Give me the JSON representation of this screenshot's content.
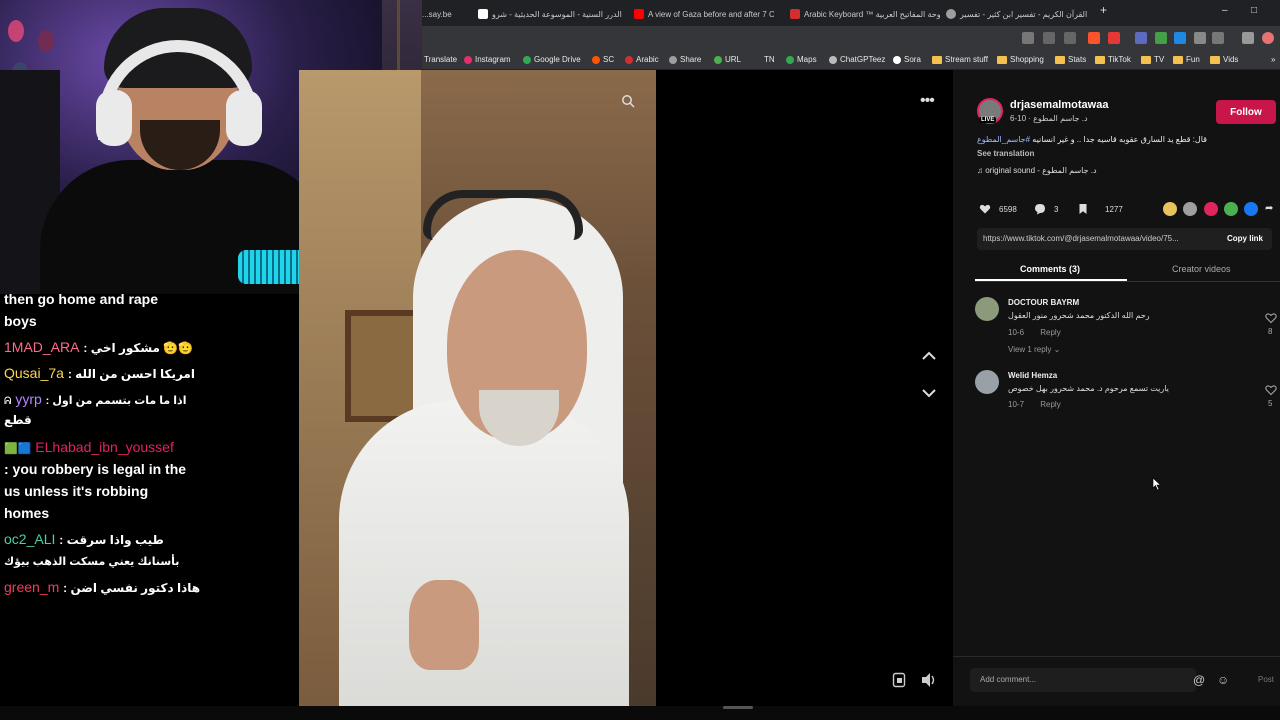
{
  "browser": {
    "tabs": [
      {
        "title": "...say.be",
        "fav_color": "#4a4a4a"
      },
      {
        "title": "الدرر السنية - الموسوعة الحديثية - شرو",
        "fav_color": "#ffffff"
      },
      {
        "title": "A view of Gaza before and after 7 Oc",
        "fav_color": "#ff0000"
      },
      {
        "title": "Arabic Keyboard ™ لوحة المفاتيح العربية",
        "fav_color": "#d32f2f"
      },
      {
        "title": "القرآن الكريم - تفسير ابن كثير - تفسير",
        "fav_color": "#9e9e9e"
      }
    ],
    "new_tab": "+",
    "minimize": "–",
    "restore": "□",
    "bookmarks": [
      {
        "label": "Translate",
        "color": "#4285f4",
        "kind": "plain"
      },
      {
        "label": "Instagram",
        "color": "#e1306c",
        "kind": "dot"
      },
      {
        "label": "Google Drive",
        "color": "#34a853",
        "kind": "dot"
      },
      {
        "label": "SC",
        "color": "#ff5500",
        "kind": "dot"
      },
      {
        "label": "Arabic",
        "color": "#d32f2f",
        "kind": "dot"
      },
      {
        "label": "Share",
        "color": "#9e9e9e",
        "kind": "dot"
      },
      {
        "label": "URL",
        "color": "#4caf50",
        "kind": "dot"
      },
      {
        "label": "TN",
        "color": "#9e9e9e",
        "kind": "plain"
      },
      {
        "label": "Maps",
        "color": "#34a853",
        "kind": "dot"
      },
      {
        "label": "ChatGPTeez",
        "color": "#bbbbbb",
        "kind": "dot"
      },
      {
        "label": "Sora",
        "color": "#ffffff",
        "kind": "dot"
      },
      {
        "label": "Stream stuff",
        "color": "#f2c14e",
        "kind": "folder"
      },
      {
        "label": "Shopping",
        "color": "#f2c14e",
        "kind": "folder"
      },
      {
        "label": "Stats",
        "color": "#f2c14e",
        "kind": "folder"
      },
      {
        "label": "TikTok",
        "color": "#f2c14e",
        "kind": "folder"
      },
      {
        "label": "TV",
        "color": "#f2c14e",
        "kind": "folder"
      },
      {
        "label": "Fun",
        "color": "#f2c14e",
        "kind": "folder"
      },
      {
        "label": "Vids",
        "color": "#f2c14e",
        "kind": "folder"
      }
    ],
    "more_bookmarks": "»"
  },
  "chat": {
    "lines": [
      {
        "user": "",
        "text": "then go home and rape",
        "user_color": "#ffffff"
      },
      {
        "user": "",
        "text": "boys",
        "user_color": "#ffffff"
      },
      {
        "user": "1MAD_ARA",
        "text": ": مشكور اخي 🫡🫡",
        "user_color": "#ff6b8a"
      },
      {
        "user": "Qusai_7a",
        "text": ": امريكا احسن من الله",
        "user_color": "#ffd54f"
      },
      {
        "user": "yyrp",
        "text": ": اذا ما مات بتسمم من اول",
        "user_color": "#b388ff",
        "prefix": "ᕱ"
      },
      {
        "user": "",
        "text": "قطع",
        "user_color": "#ffffff"
      },
      {
        "user": "ELhabad_ibn_youssef",
        "text": "",
        "user_color": "#e0245e",
        "prefix": "🟩🟦"
      }
    ],
    "wrapped_message": ": you robbery is legal in the us unless it's robbing homes",
    "lines2": [
      {
        "user": "oc2_ALI",
        "text": ": طيب واذا سرقت",
        "user_color": "#4dd0a0"
      },
      {
        "user": "",
        "text": "بأسنانك يعني مسكت الذهب بيؤك",
        "user_color": "#ffffff"
      },
      {
        "user": "green_m",
        "text": ": هاذا دكتور نفسي اضن",
        "user_color": "#ef3d5a"
      }
    ]
  },
  "video": {
    "more": "•••",
    "up": "up",
    "down": "down"
  },
  "panel": {
    "username": "drjasemalmotawaa",
    "subname": "د. جاسم المطوع · 10-6",
    "live": "LIVE",
    "follow": "Follow",
    "caption_tag": "#جاسم_المطوع",
    "caption_text": "قال: قطع يد السارق عقوبه قاسيه جدا .. و غير انسانيه",
    "see_translation": "See translation",
    "sound": "♫  original sound - د. جاسم المطوع",
    "likes": "6598",
    "comments": "3",
    "saves": "1277",
    "share_colors": [
      "#e6c35c",
      "#9e9e9e",
      "#e0245e",
      "#4caf50",
      "#1877f2"
    ],
    "link": "https://www.tiktok.com/@drjasemalmotawaa/video/75...",
    "copy_link": "Copy link",
    "tab_comments": "Comments (3)",
    "tab_creator": "Creator videos",
    "comment_list": [
      {
        "name": "DOCTOUR BAYRM",
        "text": "رحم الله الدكتور محمد شحرور منور العقول",
        "date": "10-6",
        "reply": "Reply",
        "likes": "8",
        "avatar_color": "#8a9a7a"
      },
      {
        "name": "Welid Hemza",
        "text": "ياريت تسمع مرحوم د. محمد شحرور بهل خصوص",
        "date": "10-7",
        "reply": "Reply",
        "likes": "5",
        "avatar_color": "#9aa0a8"
      }
    ],
    "view_replies": "View 1 reply ⌄",
    "add_comment": "Add comment...",
    "post": "Post"
  }
}
